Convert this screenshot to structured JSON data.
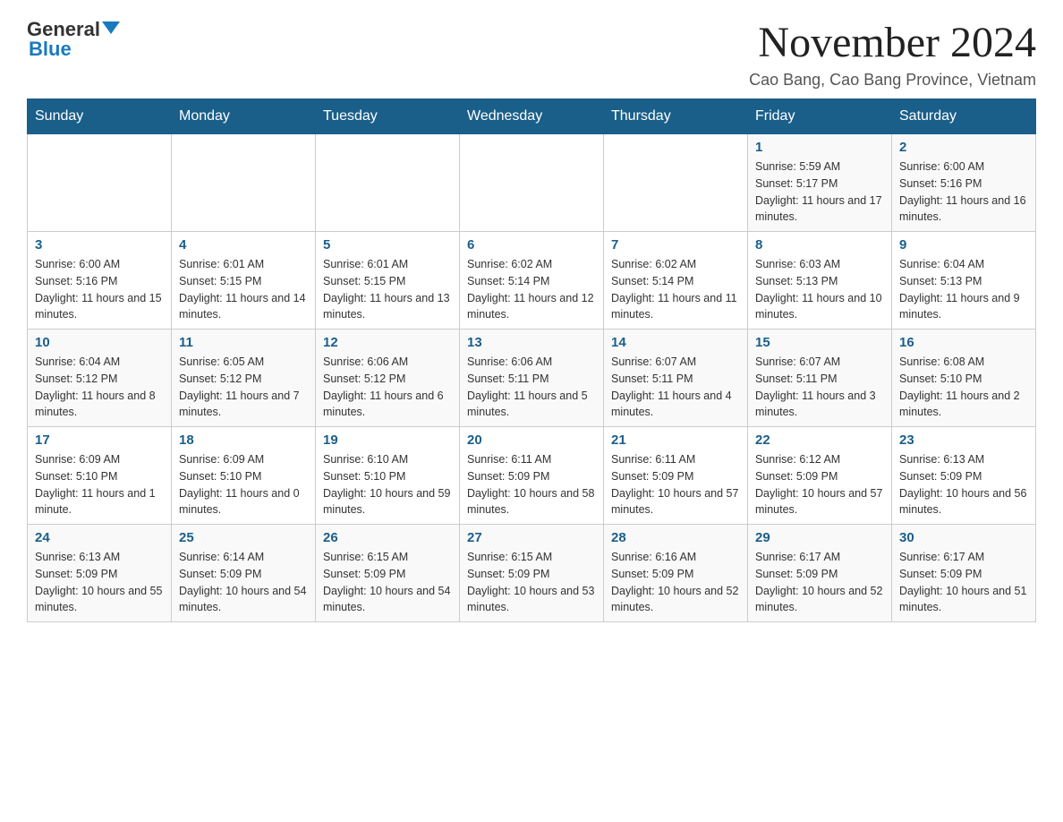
{
  "header": {
    "logo_general": "General",
    "logo_blue": "Blue",
    "main_title": "November 2024",
    "subtitle": "Cao Bang, Cao Bang Province, Vietnam"
  },
  "calendar": {
    "days_of_week": [
      "Sunday",
      "Monday",
      "Tuesday",
      "Wednesday",
      "Thursday",
      "Friday",
      "Saturday"
    ],
    "weeks": [
      [
        {
          "day": "",
          "info": ""
        },
        {
          "day": "",
          "info": ""
        },
        {
          "day": "",
          "info": ""
        },
        {
          "day": "",
          "info": ""
        },
        {
          "day": "",
          "info": ""
        },
        {
          "day": "1",
          "info": "Sunrise: 5:59 AM\nSunset: 5:17 PM\nDaylight: 11 hours and 17 minutes."
        },
        {
          "day": "2",
          "info": "Sunrise: 6:00 AM\nSunset: 5:16 PM\nDaylight: 11 hours and 16 minutes."
        }
      ],
      [
        {
          "day": "3",
          "info": "Sunrise: 6:00 AM\nSunset: 5:16 PM\nDaylight: 11 hours and 15 minutes."
        },
        {
          "day": "4",
          "info": "Sunrise: 6:01 AM\nSunset: 5:15 PM\nDaylight: 11 hours and 14 minutes."
        },
        {
          "day": "5",
          "info": "Sunrise: 6:01 AM\nSunset: 5:15 PM\nDaylight: 11 hours and 13 minutes."
        },
        {
          "day": "6",
          "info": "Sunrise: 6:02 AM\nSunset: 5:14 PM\nDaylight: 11 hours and 12 minutes."
        },
        {
          "day": "7",
          "info": "Sunrise: 6:02 AM\nSunset: 5:14 PM\nDaylight: 11 hours and 11 minutes."
        },
        {
          "day": "8",
          "info": "Sunrise: 6:03 AM\nSunset: 5:13 PM\nDaylight: 11 hours and 10 minutes."
        },
        {
          "day": "9",
          "info": "Sunrise: 6:04 AM\nSunset: 5:13 PM\nDaylight: 11 hours and 9 minutes."
        }
      ],
      [
        {
          "day": "10",
          "info": "Sunrise: 6:04 AM\nSunset: 5:12 PM\nDaylight: 11 hours and 8 minutes."
        },
        {
          "day": "11",
          "info": "Sunrise: 6:05 AM\nSunset: 5:12 PM\nDaylight: 11 hours and 7 minutes."
        },
        {
          "day": "12",
          "info": "Sunrise: 6:06 AM\nSunset: 5:12 PM\nDaylight: 11 hours and 6 minutes."
        },
        {
          "day": "13",
          "info": "Sunrise: 6:06 AM\nSunset: 5:11 PM\nDaylight: 11 hours and 5 minutes."
        },
        {
          "day": "14",
          "info": "Sunrise: 6:07 AM\nSunset: 5:11 PM\nDaylight: 11 hours and 4 minutes."
        },
        {
          "day": "15",
          "info": "Sunrise: 6:07 AM\nSunset: 5:11 PM\nDaylight: 11 hours and 3 minutes."
        },
        {
          "day": "16",
          "info": "Sunrise: 6:08 AM\nSunset: 5:10 PM\nDaylight: 11 hours and 2 minutes."
        }
      ],
      [
        {
          "day": "17",
          "info": "Sunrise: 6:09 AM\nSunset: 5:10 PM\nDaylight: 11 hours and 1 minute."
        },
        {
          "day": "18",
          "info": "Sunrise: 6:09 AM\nSunset: 5:10 PM\nDaylight: 11 hours and 0 minutes."
        },
        {
          "day": "19",
          "info": "Sunrise: 6:10 AM\nSunset: 5:10 PM\nDaylight: 10 hours and 59 minutes."
        },
        {
          "day": "20",
          "info": "Sunrise: 6:11 AM\nSunset: 5:09 PM\nDaylight: 10 hours and 58 minutes."
        },
        {
          "day": "21",
          "info": "Sunrise: 6:11 AM\nSunset: 5:09 PM\nDaylight: 10 hours and 57 minutes."
        },
        {
          "day": "22",
          "info": "Sunrise: 6:12 AM\nSunset: 5:09 PM\nDaylight: 10 hours and 57 minutes."
        },
        {
          "day": "23",
          "info": "Sunrise: 6:13 AM\nSunset: 5:09 PM\nDaylight: 10 hours and 56 minutes."
        }
      ],
      [
        {
          "day": "24",
          "info": "Sunrise: 6:13 AM\nSunset: 5:09 PM\nDaylight: 10 hours and 55 minutes."
        },
        {
          "day": "25",
          "info": "Sunrise: 6:14 AM\nSunset: 5:09 PM\nDaylight: 10 hours and 54 minutes."
        },
        {
          "day": "26",
          "info": "Sunrise: 6:15 AM\nSunset: 5:09 PM\nDaylight: 10 hours and 54 minutes."
        },
        {
          "day": "27",
          "info": "Sunrise: 6:15 AM\nSunset: 5:09 PM\nDaylight: 10 hours and 53 minutes."
        },
        {
          "day": "28",
          "info": "Sunrise: 6:16 AM\nSunset: 5:09 PM\nDaylight: 10 hours and 52 minutes."
        },
        {
          "day": "29",
          "info": "Sunrise: 6:17 AM\nSunset: 5:09 PM\nDaylight: 10 hours and 52 minutes."
        },
        {
          "day": "30",
          "info": "Sunrise: 6:17 AM\nSunset: 5:09 PM\nDaylight: 10 hours and 51 minutes."
        }
      ]
    ]
  }
}
